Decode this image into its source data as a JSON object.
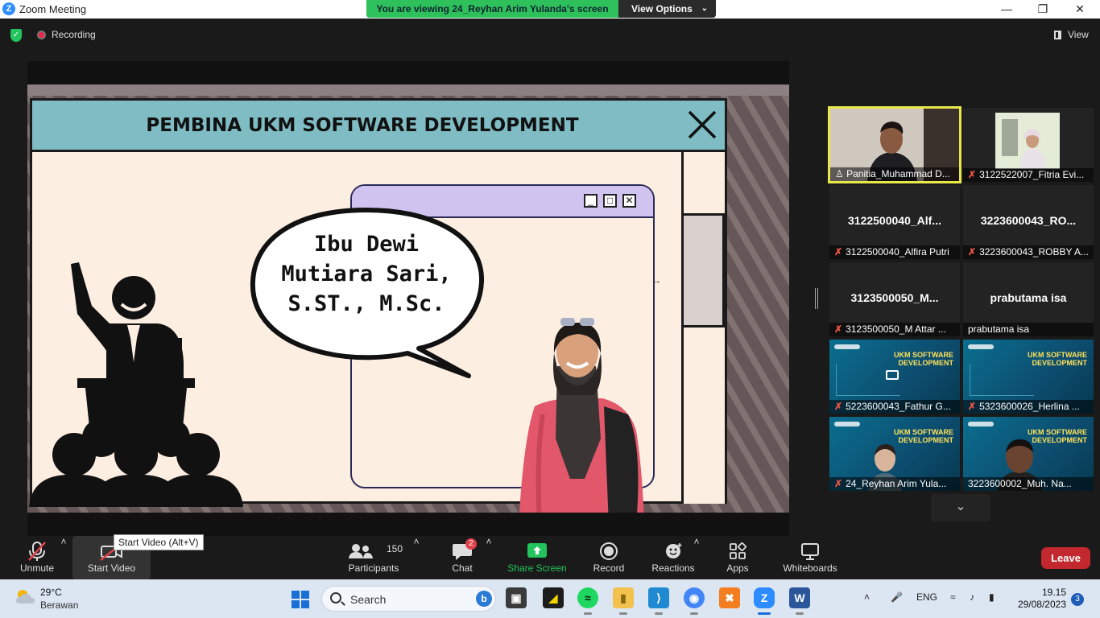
{
  "window": {
    "title": "Zoom Meeting",
    "controls": {
      "minimize": "—",
      "maximize": "❐",
      "close": "✕"
    }
  },
  "share_banner": {
    "message": "You are viewing 24_Reyhan Arim Yulanda's screen",
    "options_label": "View Options"
  },
  "top_bar": {
    "recording_label": "Recording",
    "view_label": "View"
  },
  "slide": {
    "title": "PEMBINA UKM SOFTWARE DEVELOPMENT",
    "speech_line1": "Ibu Dewi",
    "speech_line2": "Mutiara Sari,",
    "speech_line3": "S.ST., M.Sc."
  },
  "gallery": {
    "tiles": [
      {
        "label": "Panitia_Muhammad D...",
        "name": "",
        "type": "video-person",
        "muted": false,
        "active": true
      },
      {
        "label": "3122522007_Fitria Evi...",
        "name": "",
        "type": "video-person2",
        "muted": true,
        "active": false
      },
      {
        "label": "3122500040_Alfira Putri",
        "name": "3122500040_Alf...",
        "type": "name",
        "muted": true,
        "active": false
      },
      {
        "label": "3223600043_ROBBY A...",
        "name": "3223600043_RO...",
        "type": "name",
        "muted": true,
        "active": false
      },
      {
        "label": "3123500050_M Attar ...",
        "name": "3123500050_M...",
        "type": "name",
        "muted": true,
        "active": false
      },
      {
        "label": "prabutama isa",
        "name": "prabutama isa",
        "type": "name",
        "muted": false,
        "active": false
      },
      {
        "label": "5223600043_Fathur G...",
        "name": "",
        "type": "vbg",
        "muted": true,
        "active": false
      },
      {
        "label": "5323600026_Herlina ...",
        "name": "",
        "type": "vbg",
        "muted": true,
        "active": false
      },
      {
        "label": "24_Reyhan Arim Yula...",
        "name": "",
        "type": "vbg-person",
        "muted": true,
        "active": false
      },
      {
        "label": "3223600002_Muh. Na...",
        "name": "",
        "type": "vbg-person",
        "muted": false,
        "active": false
      }
    ],
    "vbg_text_line1": "UKM SOFTWARE",
    "vbg_text_line2": "DEVELOPMENT",
    "scroll_down_icon": "chevron-down-icon"
  },
  "controls": {
    "unmute": "Unmute",
    "start_video": "Start Video",
    "start_video_tooltip": "Start Video (Alt+V)",
    "participants": "Participants",
    "participants_count": "150",
    "chat": "Chat",
    "chat_badge": "2",
    "share_screen": "Share Screen",
    "record": "Record",
    "reactions": "Reactions",
    "apps": "Apps",
    "whiteboards": "Whiteboards",
    "leave": "Leave",
    "share_color": "#23c45e",
    "leave_color": "#c2282e"
  },
  "taskbar": {
    "temperature": "29°C",
    "condition": "Berawan",
    "search_placeholder": "Search",
    "language": "ENG",
    "time": "19.15",
    "date": "29/08/2023",
    "notification_count": "3"
  }
}
